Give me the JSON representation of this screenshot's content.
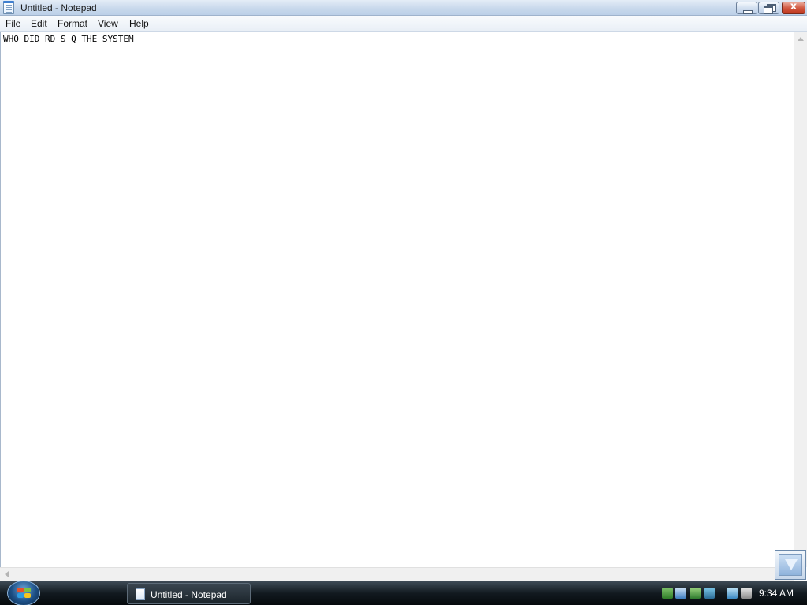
{
  "window": {
    "title": "Untitled - Notepad",
    "close_glyph": "x"
  },
  "menu": {
    "items": [
      {
        "label": "File"
      },
      {
        "label": "Edit"
      },
      {
        "label": "Format"
      },
      {
        "label": "View"
      },
      {
        "label": "Help"
      }
    ]
  },
  "editor": {
    "content": "WHO DID RD S Q THE SYSTEM"
  },
  "taskbar": {
    "active_window_label": "Untitled - Notepad",
    "clock": "9:34 AM",
    "tray_icons": [
      "network-icon",
      "monitor-icon",
      "shield-icon",
      "display-icon",
      "network-connection-icon",
      "volume-muted-icon"
    ]
  }
}
